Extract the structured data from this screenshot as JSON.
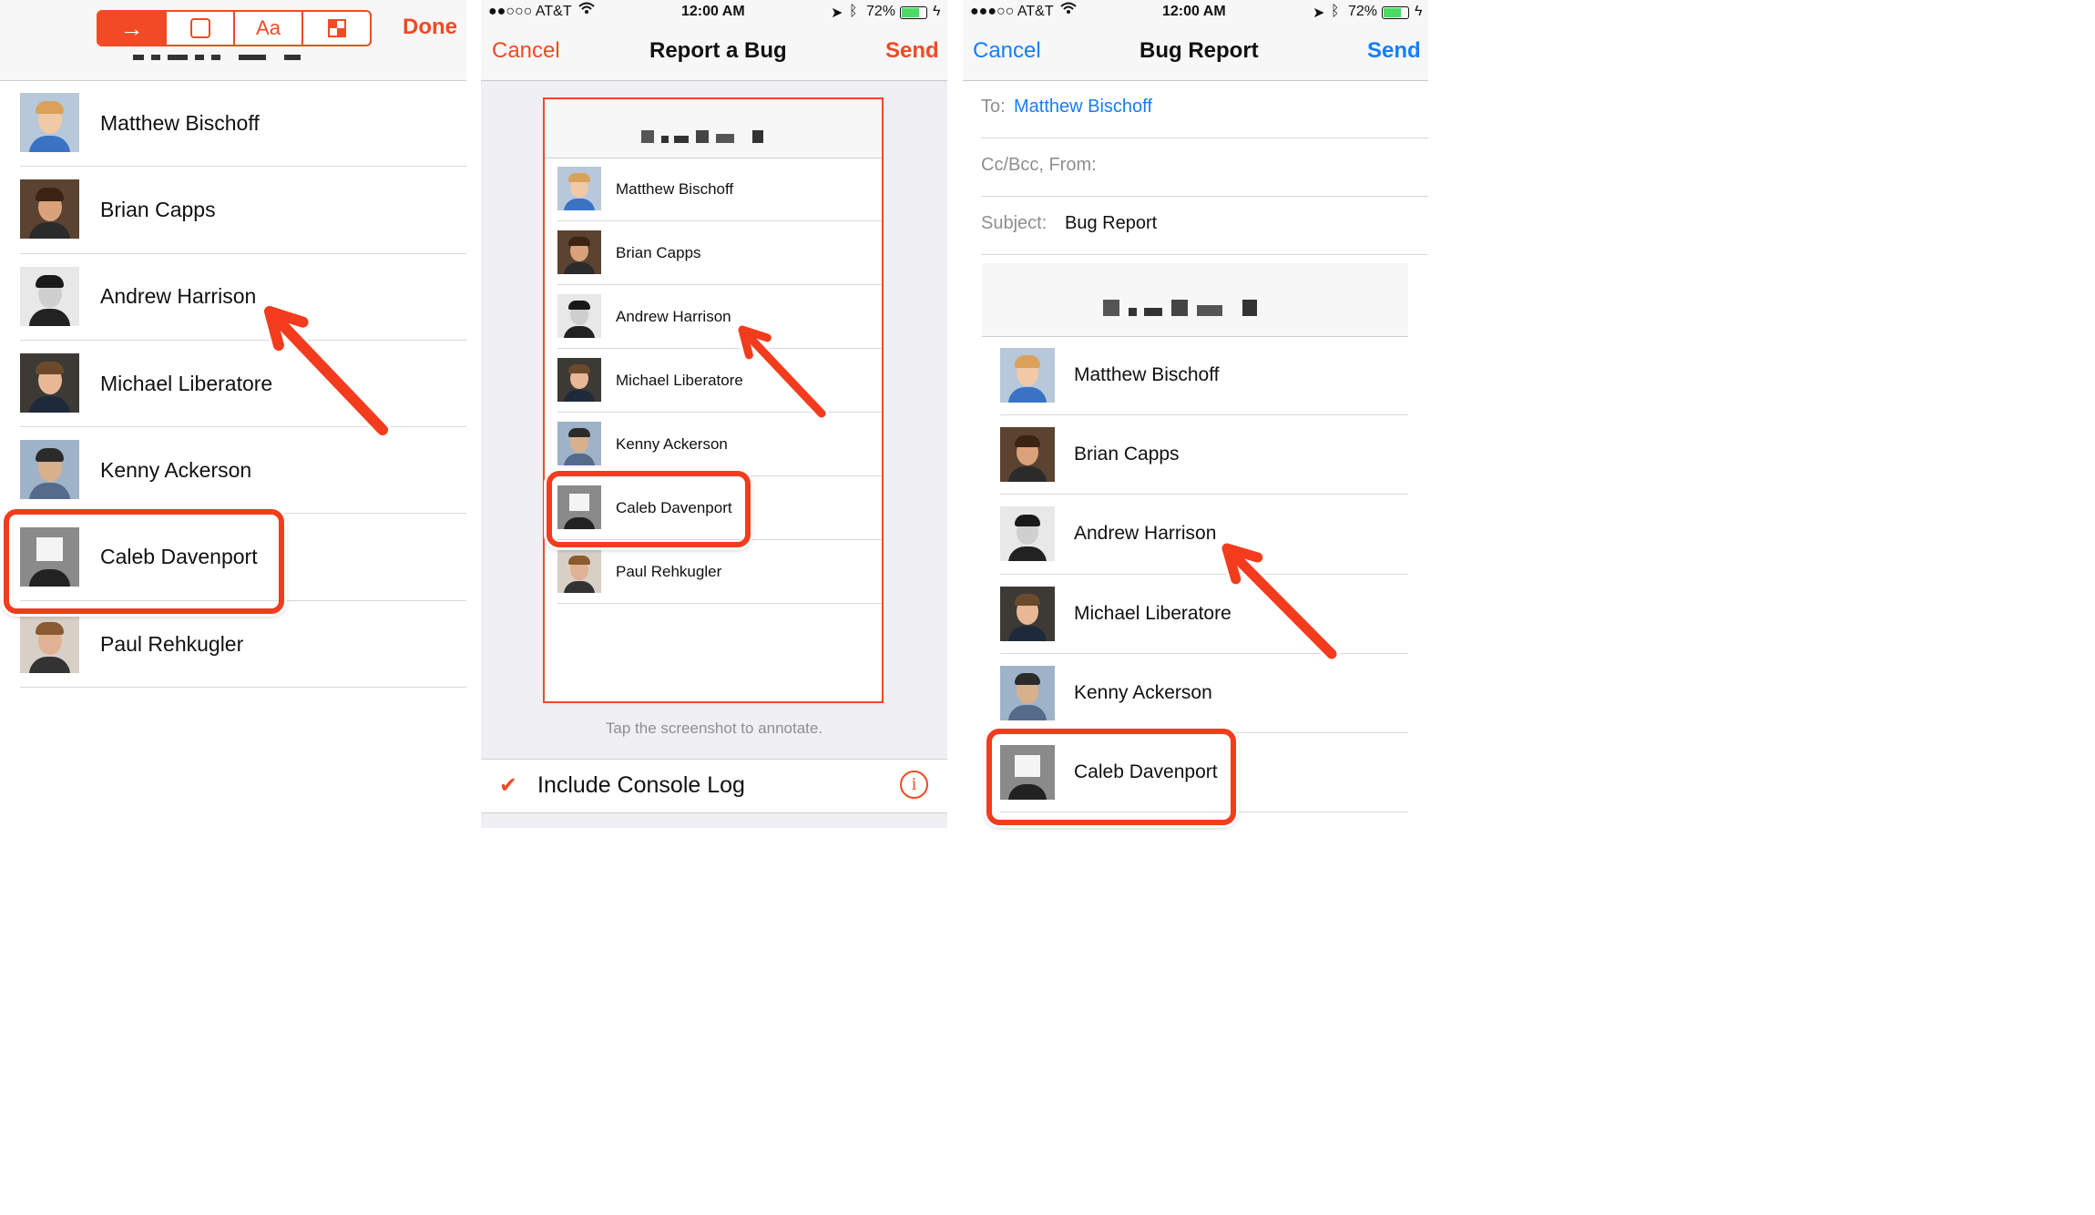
{
  "colors": {
    "accent_orange": "#f14a24",
    "ios_blue": "#147efb",
    "annot_red": "#f23c1d"
  },
  "contacts": [
    {
      "name": "Matthew Bischoff",
      "avatar_icon": "avatar-blonde"
    },
    {
      "name": "Brian Capps",
      "avatar_icon": "avatar-brown-hair"
    },
    {
      "name": "Andrew Harrison",
      "avatar_icon": "avatar-bw-portrait"
    },
    {
      "name": "Michael Liberatore",
      "avatar_icon": "avatar-smiling"
    },
    {
      "name": "Kenny Ackerson",
      "avatar_icon": "avatar-outdoor"
    },
    {
      "name": "Caleb Davenport",
      "avatar_icon": "avatar-box-head"
    },
    {
      "name": "Paul Rehkugler",
      "avatar_icon": "avatar-bearded"
    }
  ],
  "panel1": {
    "toolbar": {
      "tools": [
        {
          "icon": "arrow-right-icon",
          "label": "→",
          "active": true
        },
        {
          "icon": "rounded-square-icon",
          "label": "",
          "active": false
        },
        {
          "icon": "text-icon",
          "label": "Aa",
          "active": false
        },
        {
          "icon": "pixelate-icon",
          "label": "",
          "active": false
        }
      ],
      "done_label": "Done"
    }
  },
  "panel2": {
    "status": {
      "carrier": "●●○○○ AT&T",
      "time": "12:00 AM",
      "battery": "72%"
    },
    "nav": {
      "cancel": "Cancel",
      "title": "Report a Bug",
      "send": "Send"
    },
    "hint": "Tap the screenshot to annotate.",
    "console_log": {
      "label": "Include Console Log",
      "checked": true,
      "check_glyph": "✔",
      "info_glyph": "i"
    }
  },
  "panel3": {
    "status": {
      "carrier": "●●●○○ AT&T",
      "time": "12:00 AM",
      "battery": "72%"
    },
    "nav": {
      "cancel": "Cancel",
      "title": "Bug Report",
      "send": "Send"
    },
    "to_label": "To:",
    "to_value": "Matthew Bischoff",
    "ccbcc_label": "Cc/Bcc, From:",
    "subject_label": "Subject:",
    "subject_value": "Bug Report"
  }
}
